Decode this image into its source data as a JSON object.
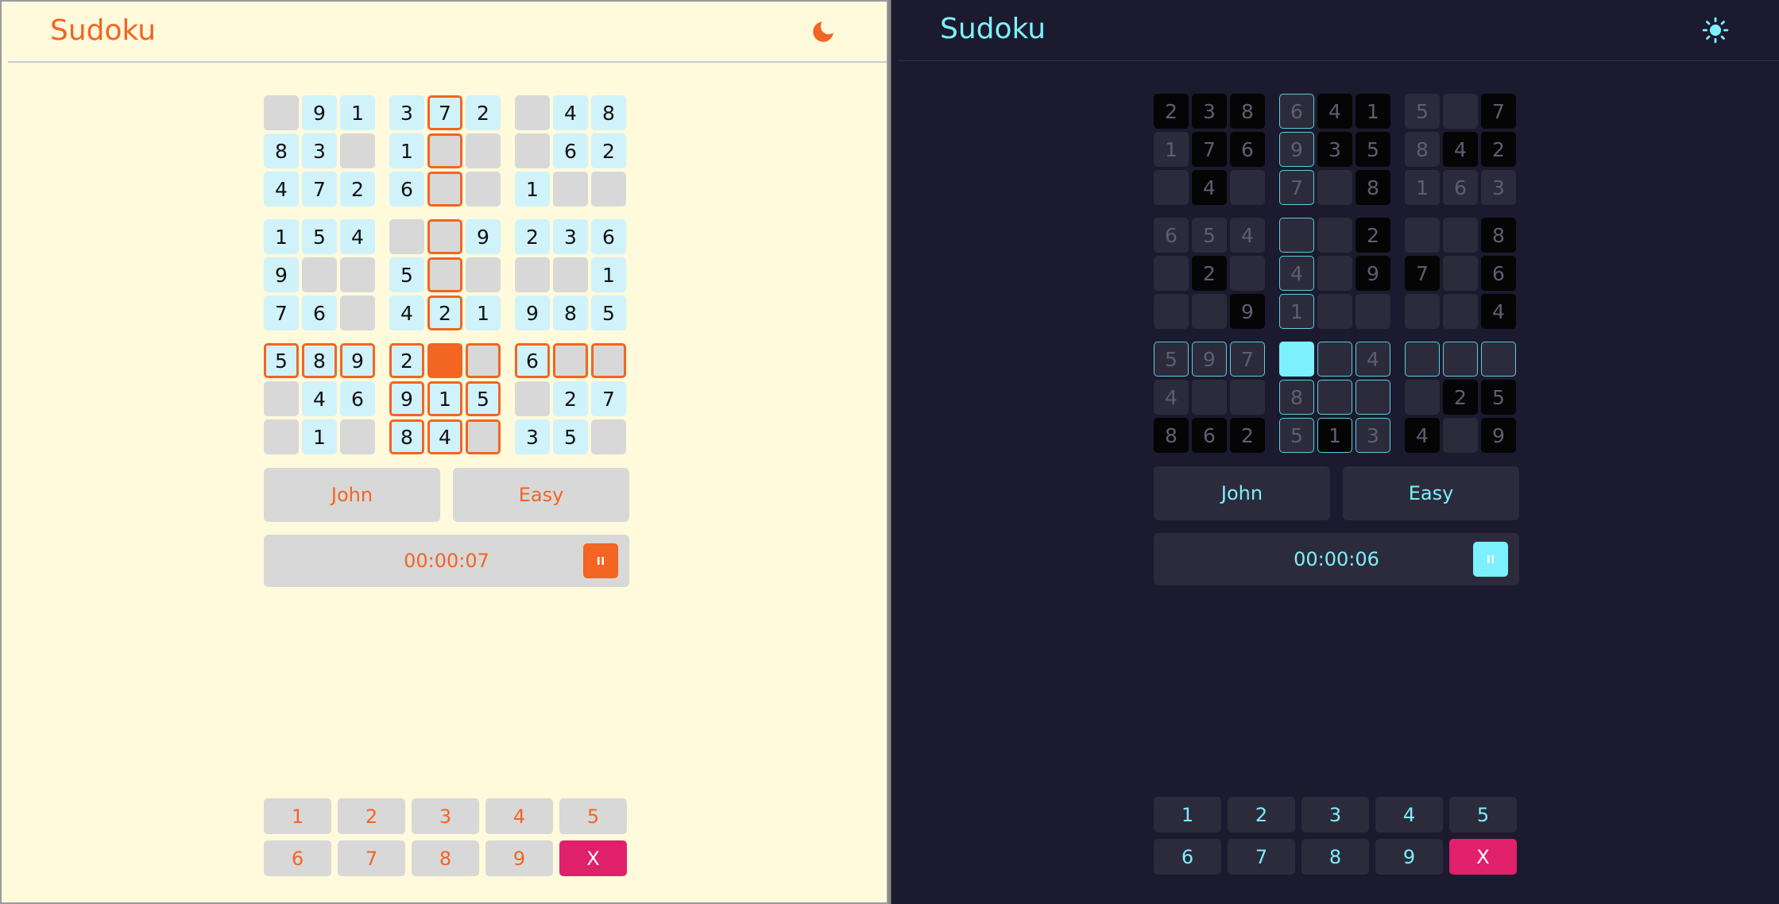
{
  "colors": {
    "light_accent": "#f26522",
    "dark_accent": "#7df0fd",
    "erase": "#e0206a",
    "light_bg": "#fefadb",
    "dark_bg": "#1b1a2e"
  },
  "light": {
    "title": "Sudoku",
    "theme_icon": "moon-icon",
    "grid": [
      [
        "",
        "9",
        "1",
        "3",
        "7",
        "2",
        "",
        "4",
        "8"
      ],
      [
        "8",
        "3",
        "",
        "1",
        "",
        "",
        "",
        "6",
        "2"
      ],
      [
        "4",
        "7",
        "2",
        "6",
        "",
        "",
        "1",
        "",
        ""
      ],
      [
        "1",
        "5",
        "4",
        "",
        "",
        "9",
        "2",
        "3",
        "6"
      ],
      [
        "9",
        "",
        "",
        "5",
        "",
        "",
        "",
        "",
        "1"
      ],
      [
        "7",
        "6",
        "",
        "4",
        "2",
        "1",
        "9",
        "8",
        "5"
      ],
      [
        "5",
        "8",
        "9",
        "2",
        "",
        "",
        "6",
        "",
        ""
      ],
      [
        "",
        "4",
        "6",
        "9",
        "1",
        "5",
        "",
        "2",
        "7"
      ],
      [
        "",
        "1",
        "",
        "8",
        "4",
        "",
        "3",
        "5",
        ""
      ]
    ],
    "selected": [
      6,
      4
    ],
    "player": "John",
    "difficulty": "Easy",
    "timer": "00:00:07",
    "pause_icon": "pause-icon",
    "numbers": [
      "1",
      "2",
      "3",
      "4",
      "5",
      "6",
      "7",
      "8",
      "9"
    ],
    "erase_label": "X"
  },
  "dark": {
    "title": "Sudoku",
    "theme_icon": "sun-icon",
    "grid": [
      [
        "2",
        "3",
        "8",
        "6",
        "4",
        "1",
        "5",
        "",
        "7"
      ],
      [
        "1",
        "7",
        "6",
        "9",
        "3",
        "5",
        "8",
        "4",
        "2"
      ],
      [
        "",
        "4",
        "",
        "7",
        "",
        "8",
        "1",
        "6",
        "3"
      ],
      [
        "6",
        "5",
        "4",
        "",
        "",
        "2",
        "",
        "",
        "8"
      ],
      [
        "",
        "2",
        "",
        "4",
        "",
        "9",
        "7",
        "",
        "6"
      ],
      [
        "",
        "",
        "9",
        "1",
        "",
        "",
        "",
        "",
        "4"
      ],
      [
        "5",
        "9",
        "7",
        "",
        "",
        "4",
        "",
        "",
        ""
      ],
      [
        "4",
        "",
        "",
        "8",
        "",
        "",
        "",
        "2",
        "5"
      ],
      [
        "8",
        "6",
        "2",
        "5",
        "1",
        "3",
        "4",
        "",
        "9"
      ]
    ],
    "given": [
      [
        1,
        1,
        1,
        0,
        1,
        1,
        0,
        0,
        1
      ],
      [
        0,
        1,
        1,
        0,
        1,
        1,
        0,
        1,
        1
      ],
      [
        0,
        1,
        0,
        0,
        0,
        1,
        0,
        0,
        0
      ],
      [
        0,
        0,
        0,
        0,
        0,
        1,
        0,
        0,
        1
      ],
      [
        0,
        1,
        0,
        0,
        0,
        1,
        1,
        0,
        1
      ],
      [
        0,
        0,
        1,
        0,
        0,
        0,
        0,
        0,
        1
      ],
      [
        0,
        0,
        0,
        0,
        0,
        0,
        0,
        0,
        0
      ],
      [
        0,
        0,
        0,
        0,
        0,
        0,
        0,
        1,
        1
      ],
      [
        1,
        1,
        1,
        0,
        1,
        0,
        1,
        0,
        1
      ]
    ],
    "selected": [
      6,
      3
    ],
    "player": "John",
    "difficulty": "Easy",
    "timer": "00:00:06",
    "pause_icon": "pause-icon",
    "numbers": [
      "1",
      "2",
      "3",
      "4",
      "5",
      "6",
      "7",
      "8",
      "9"
    ],
    "erase_label": "X"
  }
}
